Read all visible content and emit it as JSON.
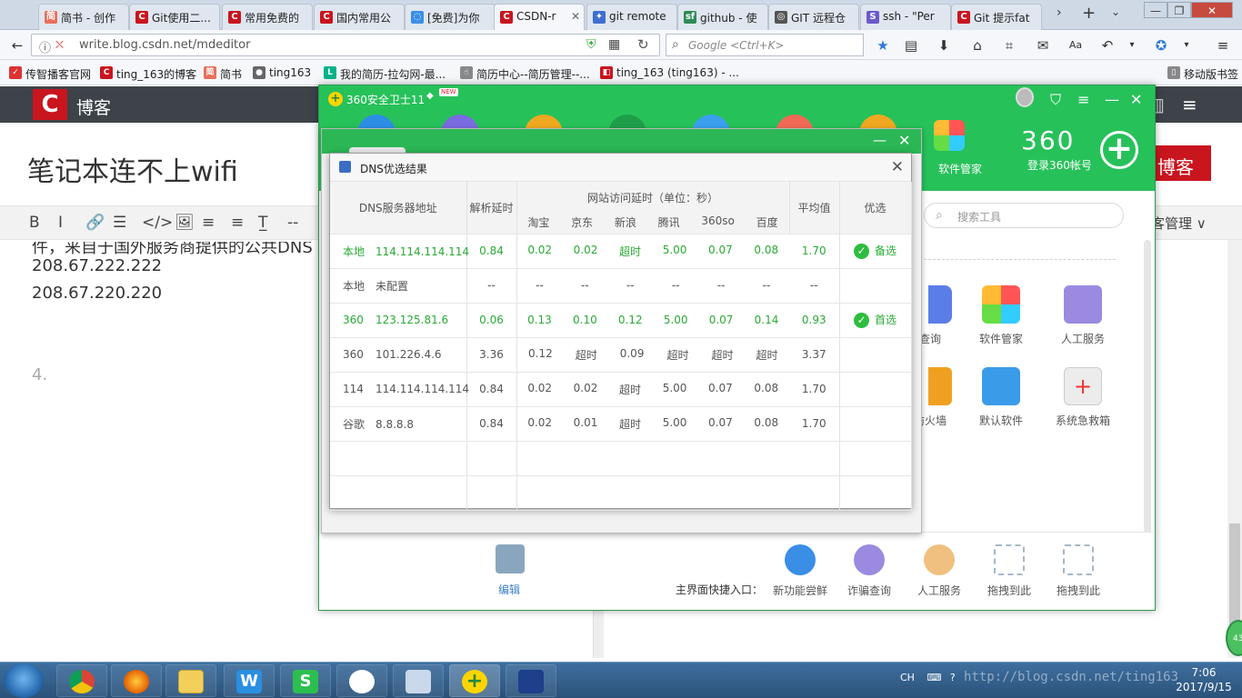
{
  "browser": {
    "tabs": [
      {
        "label": "简书 - 创作",
        "fav": "简",
        "color": "#ea6f5a"
      },
      {
        "label": "Git使用二...",
        "fav": "C",
        "color": "#c9151e"
      },
      {
        "label": "常用免费的",
        "fav": "C",
        "color": "#c9151e"
      },
      {
        "label": "国内常用公",
        "fav": "C",
        "color": "#c9151e"
      },
      {
        "label": "[免费]为你",
        "fav": "◌",
        "color": "#3a8ee6"
      },
      {
        "label": "CSDN-r",
        "fav": "C",
        "color": "#c9151e"
      },
      {
        "label": "git remote",
        "fav": "✦",
        "color": "#3f6fd1"
      },
      {
        "label": "github - 使",
        "fav": "sf",
        "color": "#2e8b57"
      },
      {
        "label": "GIT 远程仓",
        "fav": "◎",
        "color": "#555555"
      },
      {
        "label": "ssh - \"Per",
        "fav": "S",
        "color": "#6a5acd"
      },
      {
        "label": "Git 提示fat",
        "fav": "C",
        "color": "#c9151e"
      }
    ],
    "url": "write.blog.csdn.net/mdeditor",
    "search_placeholder": "Google <Ctrl+K>",
    "bookmarks": [
      {
        "label": "传智播客官网",
        "icon": "✓",
        "color": "#d33"
      },
      {
        "label": "ting_163的博客",
        "icon": "C",
        "color": "#c9151e"
      },
      {
        "label": "简书",
        "icon": "简",
        "color": "#ea6f5a"
      },
      {
        "label": "ting163",
        "icon": "●",
        "color": "#666666"
      },
      {
        "label": "我的简历-拉勾网-最...",
        "icon": "L",
        "color": "#00b38a"
      },
      {
        "label": "简历中心--简历管理--...",
        "icon": "☝",
        "color": "#888888"
      },
      {
        "label": "ting_163 (ting163) - ...",
        "icon": "◧",
        "color": "#c9151e"
      }
    ],
    "mobile_bookmarks": "移动版书签"
  },
  "csdn": {
    "logo": "C",
    "blog_label": "博客",
    "article_title": "笔记本连不上wifi",
    "toolbar": [
      "B",
      "I",
      "🔗",
      "☰",
      "</>",
      "🖼",
      "≡",
      "≡",
      "T̲",
      "--"
    ],
    "body_partial": "件，来自于国外服务商提供的公共DNS",
    "lines": [
      "208.67.222.222",
      "208.67.220.220",
      "4."
    ],
    "publish_label": "博客",
    "manage_label": "客管理 ∨"
  },
  "app360": {
    "title": "360安全卫士11",
    "new_badge": "NEW",
    "logo": "360",
    "login": "登录360帐号",
    "software_manager": "软件管家",
    "search_placeholder": "搜索工具",
    "tools_row1": [
      {
        "label": "查询",
        "color": "#5b7de8"
      },
      {
        "label": "软件管家",
        "color": "#f0a020"
      },
      {
        "label": "人工服务",
        "color": "#9b8ae0"
      }
    ],
    "tools_row2": [
      {
        "label": "防火墙",
        "color": "#f0a020"
      },
      {
        "label": "默认软件",
        "color": "#3a9be8"
      },
      {
        "label": "系统急救箱",
        "color": "#e9e9e9"
      }
    ],
    "edit_label": "编辑",
    "quick_label": "主界面快捷入口：",
    "quick_items": [
      {
        "label": "新功能尝鲜",
        "color": "#3a8ee6",
        "dashed": false
      },
      {
        "label": "诈骗查询",
        "color": "#9b8ae0",
        "dashed": false
      },
      {
        "label": "人工服务",
        "color": "#f0c080",
        "dashed": false
      },
      {
        "label": "拖拽到此",
        "color": "",
        "dashed": true
      },
      {
        "label": "拖拽到此",
        "color": "",
        "dashed": true
      }
    ]
  },
  "dns": {
    "title": "DNS优选结果",
    "headers": {
      "server": "DNS服务器地址",
      "resolve": "解析延时",
      "site_group": "网站访问延时（单位：秒）",
      "sites": [
        "淘宝",
        "京东",
        "新浪",
        "腾讯",
        "360so",
        "百度"
      ],
      "avg": "平均值",
      "best": "优选"
    },
    "rows": [
      {
        "src": "本地",
        "addr": "114.114.114.114",
        "resolve": "0.84",
        "sites": [
          "0.02",
          "0.02",
          "超时",
          "5.00",
          "0.07",
          "0.08"
        ],
        "avg": "1.70",
        "best": "备选",
        "highlight": true
      },
      {
        "src": "本地",
        "addr": "未配置",
        "resolve": "--",
        "sites": [
          "--",
          "--",
          "--",
          "--",
          "--",
          "--"
        ],
        "avg": "--",
        "best": "",
        "highlight": false
      },
      {
        "src": "360",
        "addr": "123.125.81.6",
        "resolve": "0.06",
        "sites": [
          "0.13",
          "0.10",
          "0.12",
          "5.00",
          "0.07",
          "0.14"
        ],
        "avg": "0.93",
        "best": "首选",
        "highlight": true
      },
      {
        "src": "360",
        "addr": "101.226.4.6",
        "resolve": "3.36",
        "sites": [
          "0.12",
          "超时",
          "0.09",
          "超时",
          "超时",
          "超时"
        ],
        "avg": "3.37",
        "best": "",
        "highlight": false
      },
      {
        "src": "114",
        "addr": "114.114.114.114",
        "resolve": "0.84",
        "sites": [
          "0.02",
          "0.02",
          "超时",
          "5.00",
          "0.07",
          "0.08"
        ],
        "avg": "1.70",
        "best": "",
        "highlight": false
      },
      {
        "src": "谷歌",
        "addr": "8.8.8.8",
        "resolve": "0.84",
        "sites": [
          "0.02",
          "0.01",
          "超时",
          "5.00",
          "0.07",
          "0.08"
        ],
        "avg": "1.70",
        "best": "",
        "highlight": false
      }
    ]
  },
  "taskbar": {
    "lang": "CH",
    "time": "7:06",
    "date": "2017/9/15",
    "watermark": "http://blog.csdn.net/ting163"
  }
}
